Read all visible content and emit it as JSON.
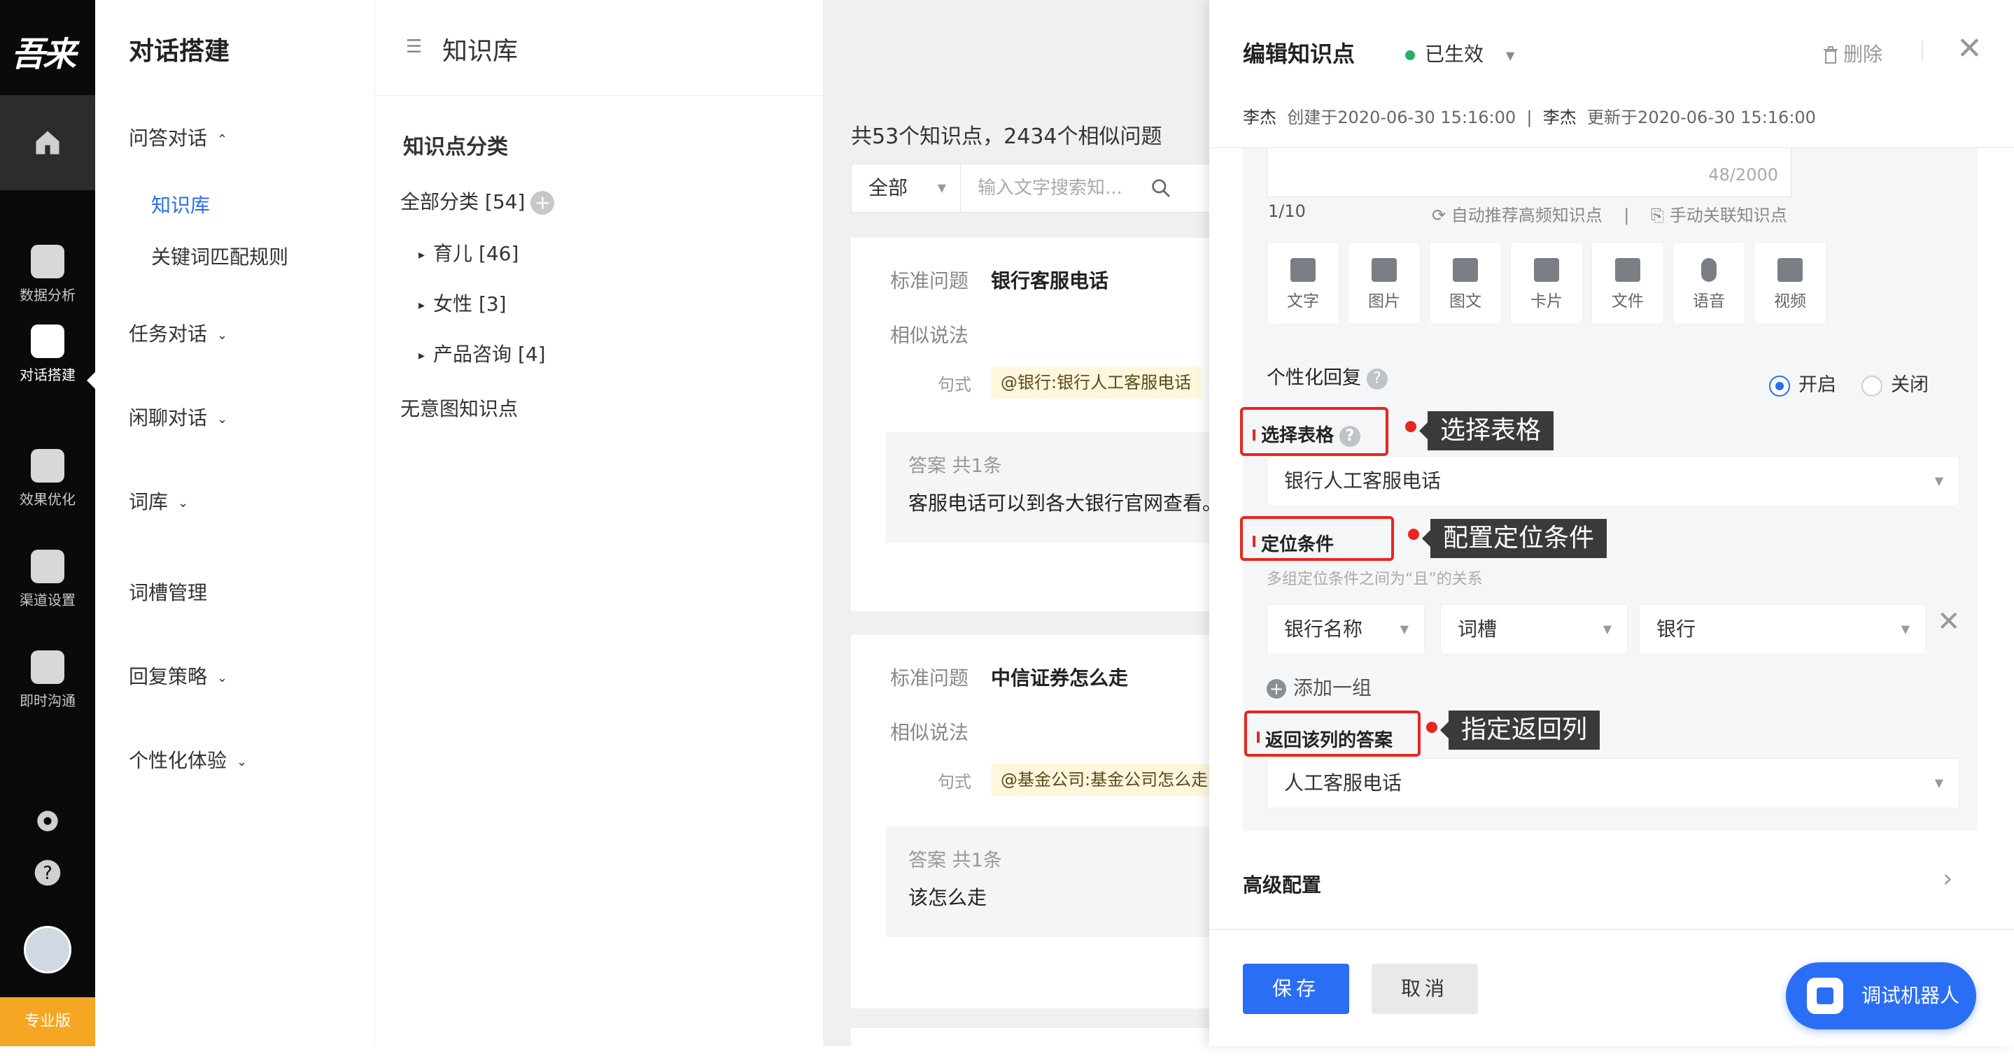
{
  "brand": {
    "logo": "吾来",
    "edition": "专业版"
  },
  "rail": {
    "items": [
      {
        "label": "数据分析",
        "icon": "chart-icon"
      },
      {
        "label": "对话搭建",
        "icon": "robot-icon"
      },
      {
        "label": "效果优化",
        "icon": "cube-icon"
      },
      {
        "label": "渠道设置",
        "icon": "channel-icon"
      },
      {
        "label": "即时沟通",
        "icon": "chat-icon"
      }
    ]
  },
  "nav": {
    "title": "对话搭建",
    "groups": [
      {
        "label": "问答对话",
        "chev": "⌃"
      },
      {
        "label": "任务对话",
        "chev": "⌄"
      },
      {
        "label": "闲聊对话",
        "chev": "⌄"
      },
      {
        "label": "词库",
        "chev": "⌄"
      },
      {
        "label": "词槽管理",
        "chev": ""
      },
      {
        "label": "回复策略",
        "chev": "⌄"
      },
      {
        "label": "个性化体验",
        "chev": "⌄"
      }
    ],
    "subs": [
      "知识库",
      "关键词匹配规则"
    ]
  },
  "header": {
    "page_title": "知识库",
    "menu_icon": "☰"
  },
  "categories": {
    "heading": "知识点分类",
    "all": "全部分类 [54]",
    "items": [
      {
        "label": "育儿 [46]"
      },
      {
        "label": "女性 [3]"
      },
      {
        "label": "产品咨询 [4]"
      }
    ],
    "no_intent": "无意图知识点"
  },
  "list": {
    "count_text": "共53个知识点，2434个相似问题",
    "filter_value": "全部",
    "search_placeholder": "输入文字搜索知...",
    "cards": [
      {
        "std_label": "标准问题",
        "std_q": "银行客服电话",
        "sim_label": "相似说法",
        "pattern_label": "句式",
        "tag": "@银行:银行人工客服电话",
        "ans_head": "答案  共1条",
        "ans_text": "客服电话可以到各大银行官网查看。"
      },
      {
        "std_label": "标准问题",
        "std_q": "中信证券怎么走",
        "sim_label": "相似说法",
        "pattern_label": "句式",
        "tag": "@基金公司:基金公司怎么走",
        "ans_head": "答案  共1条",
        "ans_text": "该怎么走"
      }
    ]
  },
  "drawer": {
    "title": "编辑知识点",
    "status": "已生效",
    "delete": "删除",
    "meta": {
      "creator": "李杰",
      "created": "创建于2020-06-30 15:16:00",
      "updater": "李杰",
      "updated": "更新于2020-06-30 15:16:00"
    },
    "char_count": "48/2000",
    "pager": "1/10",
    "auto_recommend": "自动推荐高频知识点",
    "manual_link": "手动关联知识点",
    "types": [
      "文字",
      "图片",
      "图文",
      "卡片",
      "文件",
      "语音",
      "视频"
    ],
    "personal_reply": "个性化回复",
    "radio_on": "开启",
    "radio_off": "关闭",
    "select_table_label": "选择表格",
    "select_table_callout": "选择表格",
    "table_value": "银行人工客服电话",
    "locate_label": "定位条件",
    "locate_callout": "配置定位条件",
    "locate_hint": "多组定位条件之间为“且”的关系",
    "cond_field": "银行名称",
    "cond_op": "词槽",
    "cond_value": "银行",
    "add_group": "添加一组",
    "return_label": "返回该列的答案",
    "return_callout": "指定返回列",
    "return_value": "人工客服电话",
    "advanced": "高级配置",
    "save": "保存",
    "cancel": "取消",
    "debug_bot": "调试机器人"
  },
  "colors": {
    "primary": "#2a6ef5",
    "rail": "#0a0a0a",
    "accent_red": "#e8261f",
    "badge": "#f5a623",
    "status_green": "#23b26b"
  }
}
